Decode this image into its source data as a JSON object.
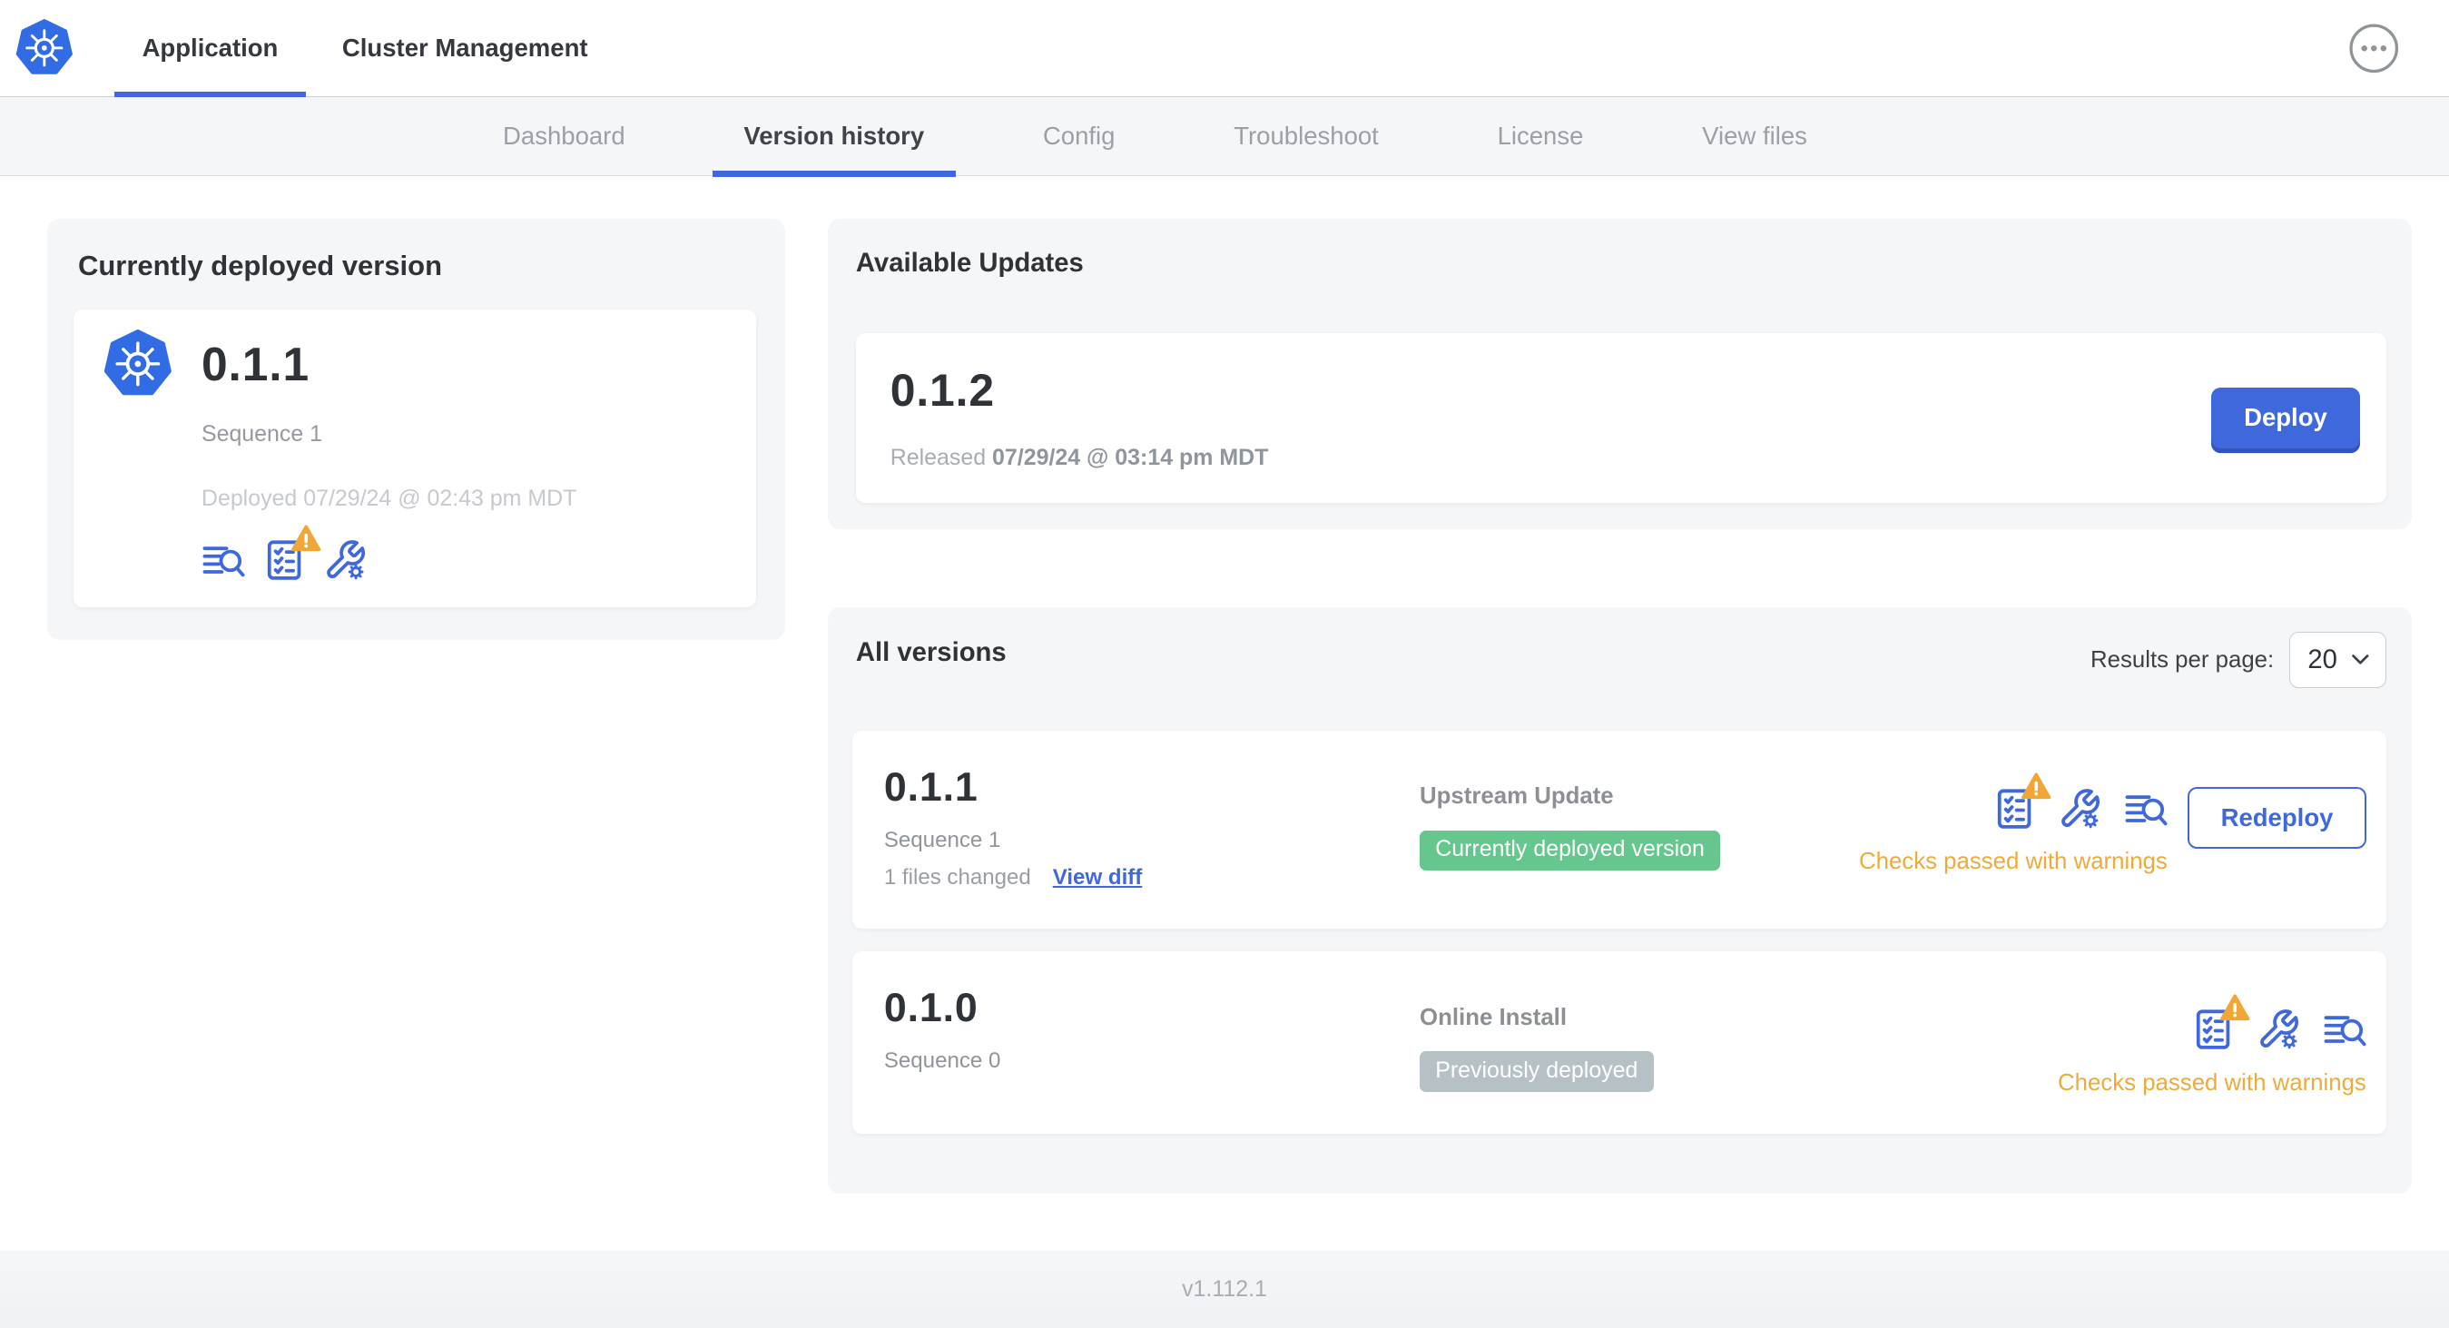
{
  "header": {
    "tabs": [
      {
        "label": "Application",
        "active": true
      },
      {
        "label": "Cluster Management",
        "active": false
      }
    ],
    "menu_icon": "ellipsis-icon"
  },
  "subnav": {
    "tabs": [
      {
        "label": "Dashboard",
        "active": false
      },
      {
        "label": "Version history",
        "active": true
      },
      {
        "label": "Config",
        "active": false
      },
      {
        "label": "Troubleshoot",
        "active": false
      },
      {
        "label": "License",
        "active": false
      },
      {
        "label": "View files",
        "active": false
      }
    ]
  },
  "current_version": {
    "panel_title": "Currently deployed version",
    "version": "0.1.1",
    "sequence": "Sequence 1",
    "deployed": "Deployed 07/29/24 @ 02:43 pm MDT",
    "icons": [
      "diff-logs-icon",
      "preflight-checks-warning-icon",
      "config-icon"
    ]
  },
  "available_updates": {
    "panel_title": "Available Updates",
    "version": "0.1.2",
    "released_prefix": "Released",
    "released_date": "07/29/24 @ 03:14 pm MDT",
    "deploy_label": "Deploy"
  },
  "all_versions": {
    "panel_title": "All versions",
    "results_per_page_label": "Results per page:",
    "results_per_page_value": "20",
    "rows": [
      {
        "version": "0.1.1",
        "sequence": "Sequence 1",
        "files_changed": "1 files changed",
        "view_diff_label": "View diff",
        "source": "Upstream Update",
        "badge": "Currently deployed version",
        "badge_color": "green",
        "icons": [
          "preflight-checks-warning-icon",
          "config-icon",
          "diff-logs-icon"
        ],
        "status": "Checks passed with warnings",
        "action_label": "Redeploy"
      },
      {
        "version": "0.1.0",
        "sequence": "Sequence 0",
        "source": "Online Install",
        "badge": "Previously deployed",
        "badge_color": "gray",
        "icons": [
          "preflight-checks-warning-icon",
          "config-icon",
          "diff-logs-icon"
        ],
        "status": "Checks passed with warnings"
      }
    ]
  },
  "footer": {
    "app_version": "v1.112.1"
  },
  "colors": {
    "accent_blue": "#3f68dd",
    "kubernetes_blue": "#326ce5",
    "green_badge": "#65c68e",
    "gray_badge": "#b6c1c5",
    "warning_amber": "#edaa3d",
    "panel_bg": "#f5f6f8"
  }
}
